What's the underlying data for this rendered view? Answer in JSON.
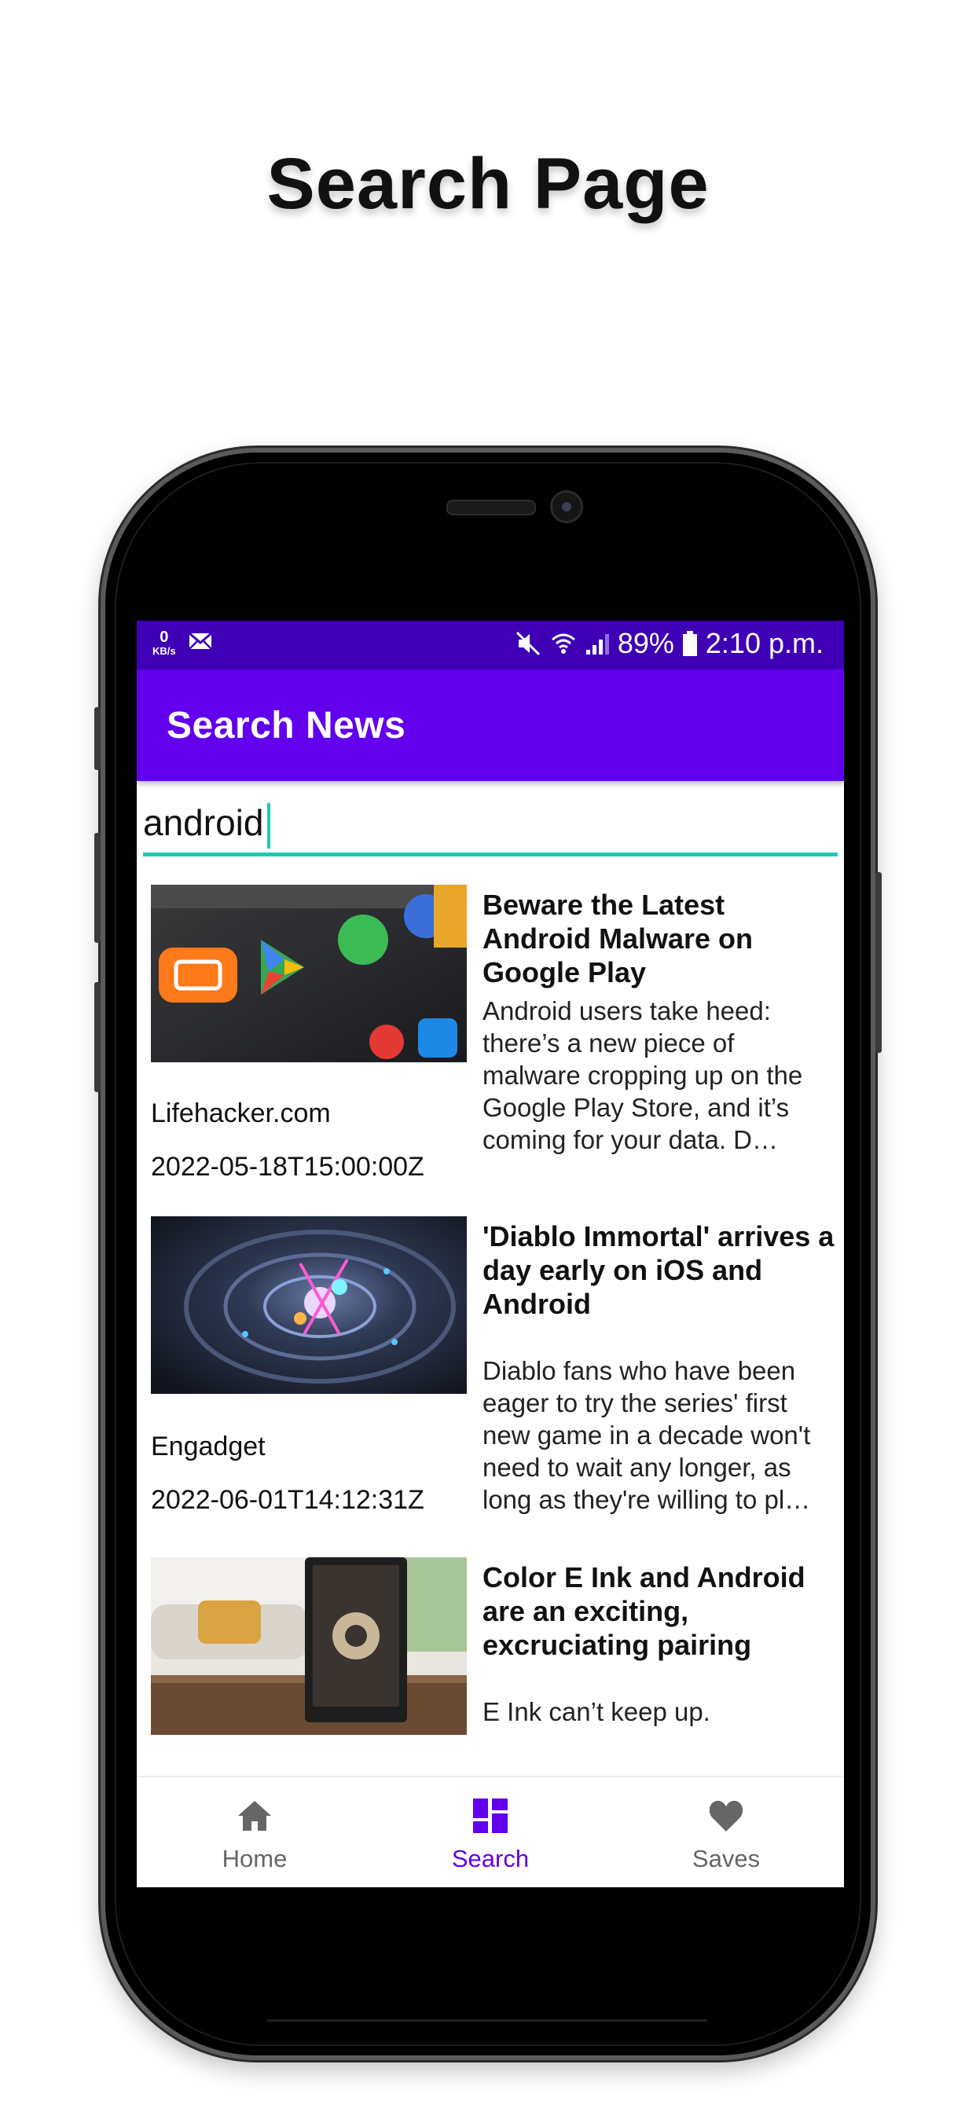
{
  "promo": {
    "title": "Search Page"
  },
  "status_bar": {
    "speed_value": "0",
    "speed_unit": "KB/s",
    "battery": "89%",
    "time": "2:10 p.m."
  },
  "app_bar": {
    "title": "Search News"
  },
  "search": {
    "value": "android",
    "placeholder": ""
  },
  "articles": [
    {
      "source": "Lifehacker.com",
      "date": "2022-05-18T15:00:00Z",
      "title": "Beware the Latest Android Malware on Google Play",
      "description": "Android users take heed: there’s a new piece of malware cropping up on the Google Play Store, and it’s coming for your data. D…"
    },
    {
      "source": "Engadget",
      "date": "2022-06-01T14:12:31Z",
      "title": "'Diablo Immortal' arrives a day early on iOS and Android",
      "description": "Diablo fans who have been eager to try the series' first new game in a decade won't need to wait any longer, as long as they're willing to pl…"
    },
    {
      "source": "",
      "date": "",
      "title": "Color E Ink and Android are an exciting, excruciating pairing",
      "description": "E Ink can’t keep up."
    }
  ],
  "bottom_nav": {
    "items": [
      {
        "label": "Home",
        "icon": "home-icon",
        "active": false
      },
      {
        "label": "Search",
        "icon": "dashboard-icon",
        "active": true
      },
      {
        "label": "Saves",
        "icon": "heart-icon",
        "active": false
      }
    ]
  },
  "colors": {
    "status_bar": "#3f00b5",
    "app_bar": "#6200ee",
    "accent": "#1fc8b8",
    "nav_active": "#6200ee",
    "nav_inactive": "#666666"
  }
}
